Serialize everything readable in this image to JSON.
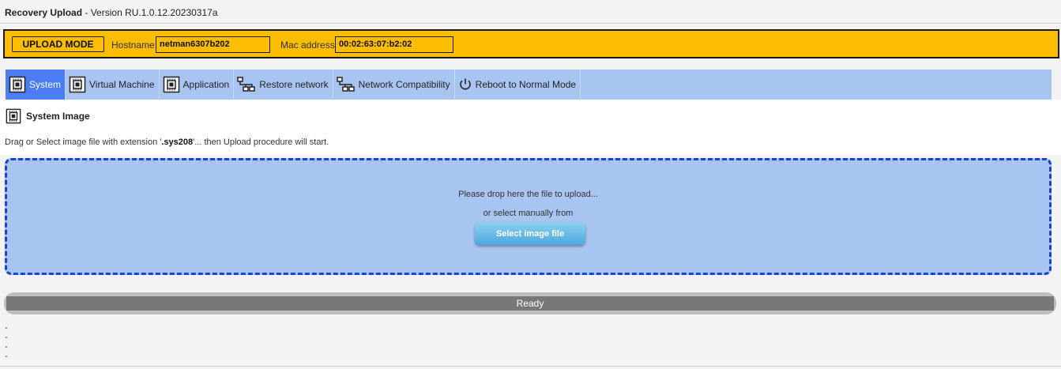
{
  "header": {
    "app_name": "Recovery Upload",
    "version_text": " - Version RU.1.0.12.20230317a"
  },
  "mode_bar": {
    "mode_label": "UPLOAD MODE",
    "hostname_label": "Hostname:",
    "hostname_value": "netman6307b202",
    "mac_label": "Mac address:",
    "mac_value": "00:02:63:07:b2:02",
    "color": "#fcbd00"
  },
  "tabs": [
    {
      "label": "System",
      "icon": "chip-icon",
      "active": true
    },
    {
      "label": "Virtual Machine",
      "icon": "chip-icon",
      "active": false
    },
    {
      "label": "Application",
      "icon": "chip-icon",
      "active": false
    },
    {
      "label": "Restore network",
      "icon": "network-icon",
      "active": false
    },
    {
      "label": "Network Compatibility",
      "icon": "network-icon",
      "active": false
    },
    {
      "label": "Reboot to Normal Mode",
      "icon": "power-icon",
      "active": false
    }
  ],
  "section": {
    "title": "System Image",
    "instruction_pre": "Drag or Select image file with extension '",
    "instruction_ext": ".sys208",
    "instruction_post": "'... then Upload procedure will start."
  },
  "drop_zone": {
    "drop_text": "Please drop here the file to upload...",
    "or_text": "or select manually from",
    "button_label": "Select image file"
  },
  "status": {
    "text": "Ready"
  },
  "log_lines": [
    "-",
    "-",
    "-",
    "-"
  ]
}
